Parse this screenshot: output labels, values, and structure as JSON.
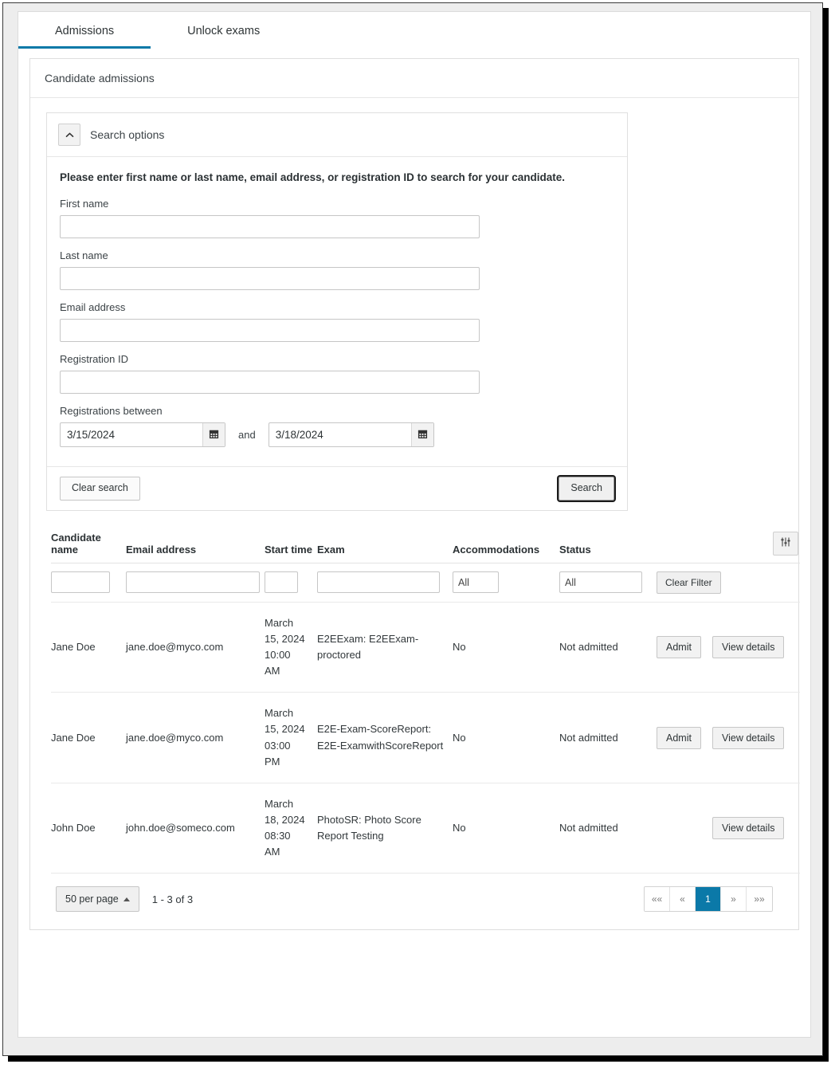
{
  "tabs": [
    {
      "label": "Admissions",
      "active": true
    },
    {
      "label": "Unlock exams",
      "active": false
    }
  ],
  "panel": {
    "title": "Candidate admissions"
  },
  "search_options": {
    "header_label": "Search options",
    "collapse_icon": "chevron-up-icon",
    "intro": "Please enter first name or last name, email address, or registration ID to search for your candidate.",
    "fields": [
      {
        "label": "First name",
        "value": "",
        "placeholder": ""
      },
      {
        "label": "Last name",
        "value": "",
        "placeholder": ""
      },
      {
        "label": "Email address",
        "value": "",
        "placeholder": ""
      },
      {
        "label": "Registration ID",
        "value": "",
        "placeholder": ""
      }
    ],
    "date_range": {
      "label": "Registrations between",
      "from": "3/15/2024",
      "to": "3/18/2024",
      "separator": "and",
      "calendar_icon": "calendar-icon"
    },
    "clear_label": "Clear search",
    "search_label": "Search"
  },
  "table": {
    "settings_icon": "sliders-icon",
    "columns": [
      "Candidate name",
      "Email address",
      "Start time",
      "Exam",
      "Accommodations",
      "Status",
      "",
      ""
    ],
    "filters": {
      "candidate_name": "",
      "email": "",
      "start_time": "",
      "exam": "",
      "accommodations": "All",
      "status": "All",
      "clear_filter_label": "Clear Filter"
    },
    "rows": [
      {
        "candidate_name": "Jane Doe",
        "email": "jane.doe@myco.com",
        "start_time": "March 15, 2024 10:00 AM",
        "exam": "E2EExam: E2EExam-proctored",
        "accommodations": "No",
        "status": "Not admitted",
        "admit_label": "Admit",
        "details_label": "View details"
      },
      {
        "candidate_name": "Jane Doe",
        "email": "jane.doe@myco.com",
        "start_time": "March 15, 2024 03:00 PM",
        "exam": "E2E-Exam-ScoreReport: E2E-ExamwithScoreReport",
        "accommodations": "No",
        "status": "Not admitted",
        "admit_label": "Admit",
        "details_label": "View details"
      },
      {
        "candidate_name": "John Doe",
        "email": "john.doe@someco.com",
        "start_time": "March 18, 2024 08:30 AM",
        "exam": "PhotoSR: Photo Score Report Testing",
        "accommodations": "No",
        "status": "Not admitted",
        "admit_label": "",
        "details_label": "View details"
      }
    ]
  },
  "footer": {
    "per_page_label": "50 per page",
    "range_label": "1 - 3 of 3",
    "pager": [
      {
        "label": "««",
        "name": "first-page",
        "active": false
      },
      {
        "label": "«",
        "name": "previous-page",
        "active": false
      },
      {
        "label": "1",
        "name": "page-1",
        "active": true
      },
      {
        "label": "»",
        "name": "next-page",
        "active": false
      },
      {
        "label": "»»",
        "name": "last-page",
        "active": false
      }
    ]
  },
  "colors": {
    "accent": "#0b79a8",
    "text": "#2e3436",
    "border": "#c6c6c6"
  }
}
